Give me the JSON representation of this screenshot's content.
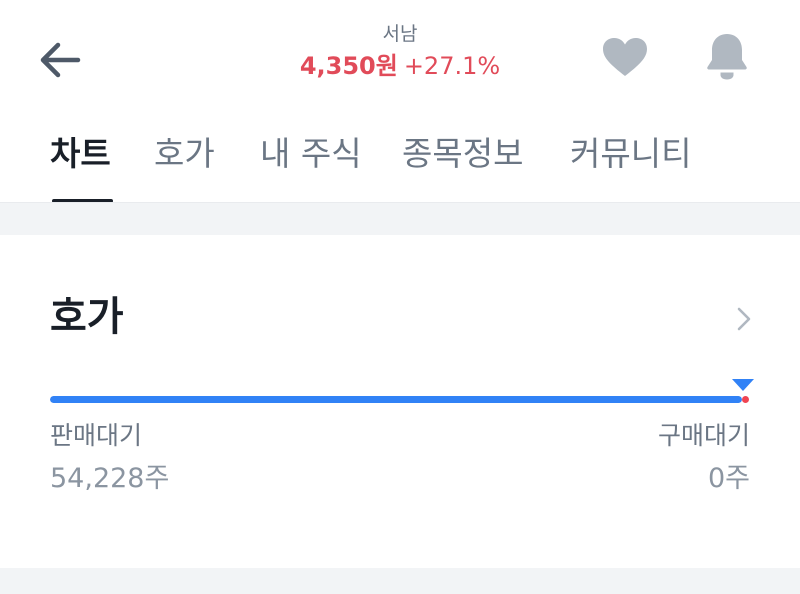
{
  "header": {
    "stock_name": "서남",
    "price": "4,350원",
    "change": "+27.1%",
    "back_icon": "arrow-left-icon",
    "favorite_icon": "heart-icon",
    "alert_icon": "bell-icon"
  },
  "tabs": [
    {
      "label": "차트",
      "active": true
    },
    {
      "label": "호가",
      "active": false
    },
    {
      "label": "내 주식",
      "active": false
    },
    {
      "label": "종목정보",
      "active": false
    },
    {
      "label": "커뮤니티",
      "active": false
    }
  ],
  "orderbook": {
    "title": "호가",
    "chevron_icon": "chevron-right-icon",
    "sell_label": "판매대기",
    "sell_value": "54,228주",
    "buy_label": "구매대기",
    "buy_value": "0주",
    "sell_ratio": 1.0,
    "marker_icon": "triangle-down-icon"
  },
  "colors": {
    "up_red": "#e14b59",
    "sell_blue": "#3182f6",
    "icon_gray": "#b0b8c1",
    "text_dark": "#191f28",
    "text_gray": "#6b7684"
  }
}
